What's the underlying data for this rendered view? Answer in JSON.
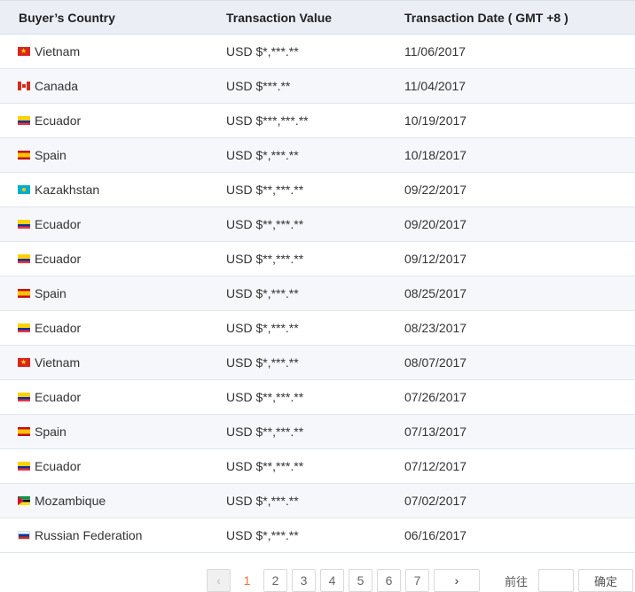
{
  "table": {
    "headers": {
      "country": "Buyer’s Country",
      "value": "Transaction Value",
      "date": "Transaction Date ( GMT +8 )"
    },
    "rows": [
      {
        "flag": "vn",
        "country": "Vietnam",
        "value": "USD $*,***.**",
        "date": "11/06/2017"
      },
      {
        "flag": "ca",
        "country": "Canada",
        "value": "USD $***.**",
        "date": "11/04/2017"
      },
      {
        "flag": "ec",
        "country": "Ecuador",
        "value": "USD $***,***.**",
        "date": "10/19/2017"
      },
      {
        "flag": "es",
        "country": "Spain",
        "value": "USD $*,***.**",
        "date": "10/18/2017"
      },
      {
        "flag": "kz",
        "country": "Kazakhstan",
        "value": "USD $**,***.**",
        "date": "09/22/2017"
      },
      {
        "flag": "ec",
        "country": "Ecuador",
        "value": "USD $**,***.**",
        "date": "09/20/2017"
      },
      {
        "flag": "ec",
        "country": "Ecuador",
        "value": "USD $**,***.**",
        "date": "09/12/2017"
      },
      {
        "flag": "es",
        "country": "Spain",
        "value": "USD $*,***.**",
        "date": "08/25/2017"
      },
      {
        "flag": "ec",
        "country": "Ecuador",
        "value": "USD $*,***.**",
        "date": "08/23/2017"
      },
      {
        "flag": "vn",
        "country": "Vietnam",
        "value": "USD $*,***.**",
        "date": "08/07/2017"
      },
      {
        "flag": "ec",
        "country": "Ecuador",
        "value": "USD $**,***.**",
        "date": "07/26/2017"
      },
      {
        "flag": "es",
        "country": "Spain",
        "value": "USD $**,***.**",
        "date": "07/13/2017"
      },
      {
        "flag": "ec",
        "country": "Ecuador",
        "value": "USD $**,***.**",
        "date": "07/12/2017"
      },
      {
        "flag": "mz",
        "country": "Mozambique",
        "value": "USD $*,***.**",
        "date": "07/02/2017"
      },
      {
        "flag": "ru",
        "country": "Russian Federation",
        "value": "USD $*,***.**",
        "date": "06/16/2017"
      }
    ]
  },
  "pagination": {
    "prev_icon": "chevron-left-icon",
    "next_icon": "chevron-right-icon",
    "pages": [
      "1",
      "2",
      "3",
      "4",
      "5",
      "6",
      "7"
    ],
    "current_page": "1",
    "goto_label": "前往",
    "goto_value": "",
    "confirm_label": "确定"
  },
  "colors": {
    "header_bg": "#ebeff5",
    "alt_row_bg": "#f5f7fa",
    "active_page": "#e8743b"
  }
}
